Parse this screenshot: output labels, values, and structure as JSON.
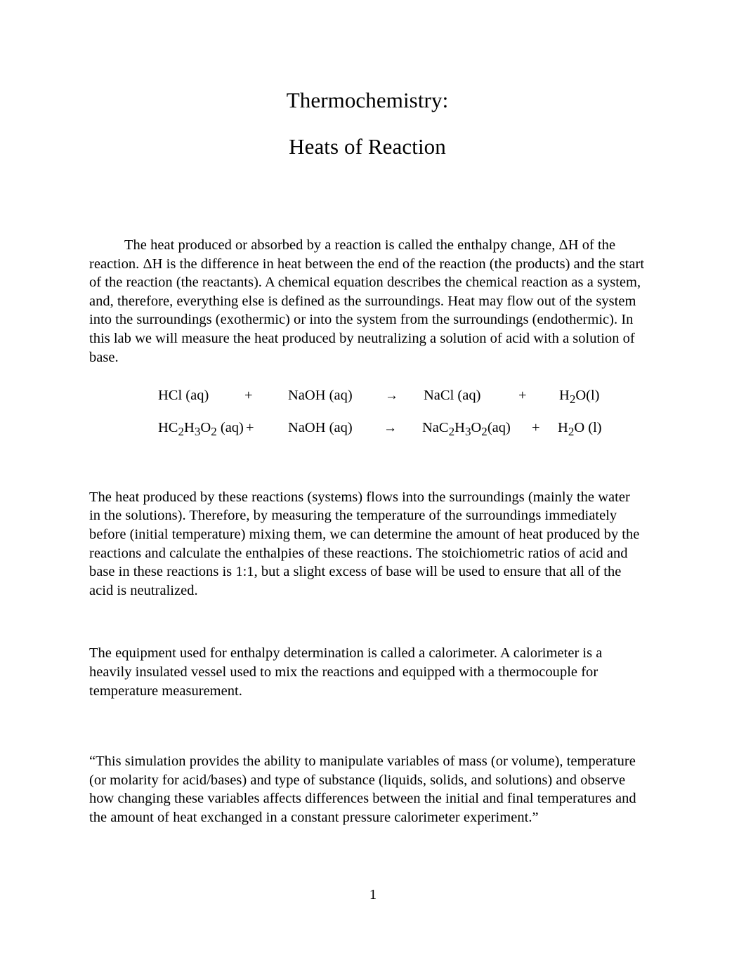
{
  "document": {
    "title_line1": "Thermochemistry:",
    "title_line2": "Heats of Reaction"
  },
  "paragraphs": {
    "intro": "The heat produced or absorbed by a reaction is called the enthalpy change, ΔH of the reaction. ΔH is the difference in heat between the end of the reaction (the products) and the start of the reaction (the reactants). A chemical equation describes the chemical reaction as a system, and, therefore, everything else is defined as the surroundings. Heat may flow out of the system into the surroundings (exothermic) or into the system from the surroundings (endothermic). In this lab we will measure the heat produced by neutralizing a solution of acid with a solution of base.",
    "heat_flow": "The heat produced by these reactions (systems) flows into the surroundings (mainly the water in the solutions). Therefore, by measuring the temperature of the surroundings immediately before (initial temperature) mixing them, we can determine the amount of heat produced by the reactions and calculate the enthalpies of these reactions. The stoichiometric ratios of acid and base in these reactions is 1:1, but a slight excess of base will be used to ensure that all of the acid is neutralized.",
    "calorimeter": "The equipment used for enthalpy determination is called a calorimeter. A calorimeter is a heavily insulated vessel used to mix the reactions and equipped with a thermocouple for temperature measurement.",
    "simulation_quote": "“This simulation provides the ability to manipulate variables of mass (or volume), temperature (or molarity for acid/bases) and type of substance (liquids, solids, and solutions) and observe how changing these variables affects differences between the initial and final temperatures and the amount of heat exchanged in a constant pressure calorimeter experiment.”"
  },
  "equations": [
    {
      "reactant1": "HCl (aq)",
      "plus1": "+",
      "reactant2": "NaOH (aq)",
      "arrow": "→",
      "product1": "NaCl (aq)",
      "plus2": "+",
      "product2_parts": [
        {
          "text": "H",
          "sub": false
        },
        {
          "text": "2",
          "sub": true
        },
        {
          "text": "O(l)",
          "sub": false
        }
      ]
    },
    {
      "reactant1_parts": [
        {
          "text": "HC",
          "sub": false
        },
        {
          "text": "2",
          "sub": true
        },
        {
          "text": "H",
          "sub": false
        },
        {
          "text": "3",
          "sub": true
        },
        {
          "text": "O",
          "sub": false
        },
        {
          "text": "2",
          "sub": true
        },
        {
          "text": " (aq)",
          "sub": false
        }
      ],
      "plus1": "+",
      "reactant2": "NaOH (aq)",
      "arrow": "→",
      "product1_parts": [
        {
          "text": "NaC",
          "sub": false
        },
        {
          "text": "2",
          "sub": true
        },
        {
          "text": "H",
          "sub": false
        },
        {
          "text": "3",
          "sub": true
        },
        {
          "text": "O",
          "sub": false
        },
        {
          "text": "2",
          "sub": true
        },
        {
          "text": "(aq)",
          "sub": false
        }
      ],
      "plus2": "+",
      "product2_parts": [
        {
          "text": "H",
          "sub": false
        },
        {
          "text": "2",
          "sub": true
        },
        {
          "text": "O (l)",
          "sub": false
        }
      ]
    }
  ],
  "footer": {
    "page_number": "1"
  }
}
